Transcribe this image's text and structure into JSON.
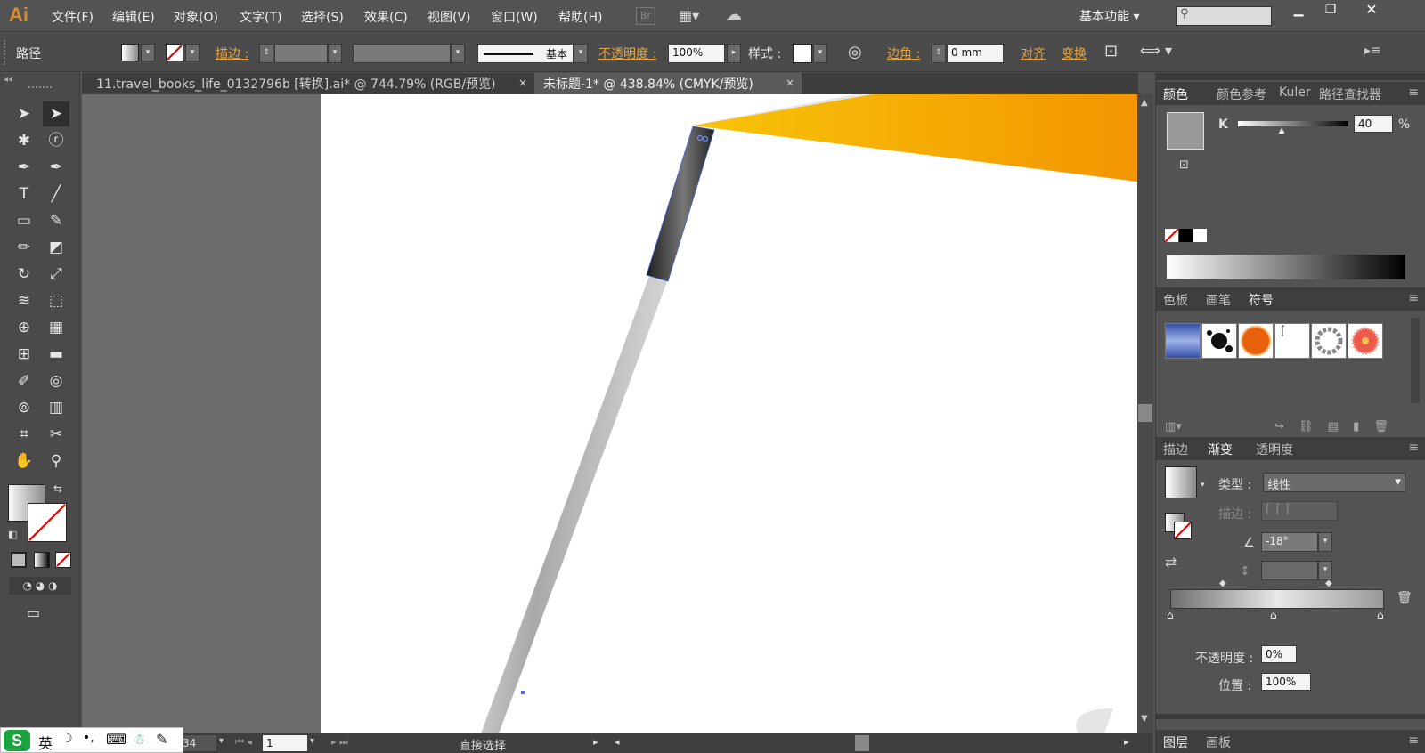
{
  "app": {
    "logo": "Ai",
    "workspace": "基本功能",
    "menu": [
      "文件(F)",
      "编辑(E)",
      "对象(O)",
      "文字(T)",
      "选择(S)",
      "效果(C)",
      "视图(V)",
      "窗口(W)",
      "帮助(H)"
    ],
    "bridge": "Br"
  },
  "control": {
    "selection_type": "路径",
    "stroke_label": "描边 :",
    "brush_label": "基本",
    "opacity_label": "不透明度 :",
    "opacity_value": "100%",
    "style_label": "样式 :",
    "corner_label": "边角 :",
    "corner_value": "0 mm",
    "align_label": "对齐",
    "transform_label": "变换"
  },
  "documents": [
    {
      "title": "11.travel_books_life_0132796b  [转换].ai* @ 744.79% (RGB/预览)",
      "close": "×"
    },
    {
      "title": "未标题-1* @ 438.84% (CMYK/预览)",
      "close": "×"
    }
  ],
  "tools": [
    {
      "name": "selection-tool",
      "glyph": "➤"
    },
    {
      "name": "direct-selection-tool",
      "glyph": "➤"
    },
    {
      "name": "magic-wand-tool",
      "glyph": "✱"
    },
    {
      "name": "lasso-tool",
      "glyph": "ⓡ"
    },
    {
      "name": "pen-tool",
      "glyph": "✒"
    },
    {
      "name": "curvature-tool",
      "glyph": "✒"
    },
    {
      "name": "type-tool",
      "glyph": "T"
    },
    {
      "name": "line-tool",
      "glyph": "╱"
    },
    {
      "name": "rectangle-tool",
      "glyph": "▭"
    },
    {
      "name": "paintbrush-tool",
      "glyph": "✎"
    },
    {
      "name": "pencil-tool",
      "glyph": "✏"
    },
    {
      "name": "eraser-tool",
      "glyph": "◩"
    },
    {
      "name": "rotate-tool",
      "glyph": "↻"
    },
    {
      "name": "scale-tool",
      "glyph": "⤢"
    },
    {
      "name": "warp-tool",
      "glyph": "≋"
    },
    {
      "name": "free-transform-tool",
      "glyph": "⬚"
    },
    {
      "name": "shape-builder-tool",
      "glyph": "⊕"
    },
    {
      "name": "perspective-grid-tool",
      "glyph": "▦"
    },
    {
      "name": "mesh-tool",
      "glyph": "⊞"
    },
    {
      "name": "gradient-tool",
      "glyph": "▬"
    },
    {
      "name": "eyedropper-tool",
      "glyph": "✐"
    },
    {
      "name": "blend-tool",
      "glyph": "◎"
    },
    {
      "name": "symbol-sprayer-tool",
      "glyph": "⊚"
    },
    {
      "name": "column-graph-tool",
      "glyph": "▥"
    },
    {
      "name": "artboard-tool",
      "glyph": "⌗"
    },
    {
      "name": "slice-tool",
      "glyph": "✂"
    },
    {
      "name": "hand-tool",
      "glyph": "✋"
    },
    {
      "name": "zoom-tool",
      "glyph": "⚲"
    }
  ],
  "status": {
    "zoom_partial": "34",
    "page": "1",
    "current_tool": "直接选择"
  },
  "color_panel": {
    "tabs": [
      "颜色",
      "颜色参考",
      "Kuler",
      "路径查找器"
    ],
    "channel": "K",
    "k_value": "40",
    "k_fraction": 0.4,
    "unit": "%"
  },
  "swatch_panel": {
    "tabs": [
      "色板",
      "画笔",
      "符号"
    ],
    "symbols": [
      "blue-banner-symbol",
      "ink-splat-symbol",
      "orange-button-symbol",
      "corner-mark-symbol",
      "ring-symbol",
      "flower-symbol"
    ]
  },
  "gradient_panel": {
    "tabs": [
      "描边",
      "渐变",
      "透明度"
    ],
    "type_label": "类型 :",
    "type_value": "线性",
    "stroke_label": "描边 :",
    "angle_value": "-18°",
    "opacity_label": "不透明度 :",
    "opacity_value": "0%",
    "location_label": "位置 :",
    "location_value": "100%"
  },
  "bottom_panel": {
    "tabs": [
      "图层",
      "画板"
    ]
  },
  "ime": {
    "lang": "英"
  },
  "colors": {
    "accent_orange": "#e8a33d",
    "banner_yellow": "#f7b500",
    "banner_orange": "#f29500"
  }
}
